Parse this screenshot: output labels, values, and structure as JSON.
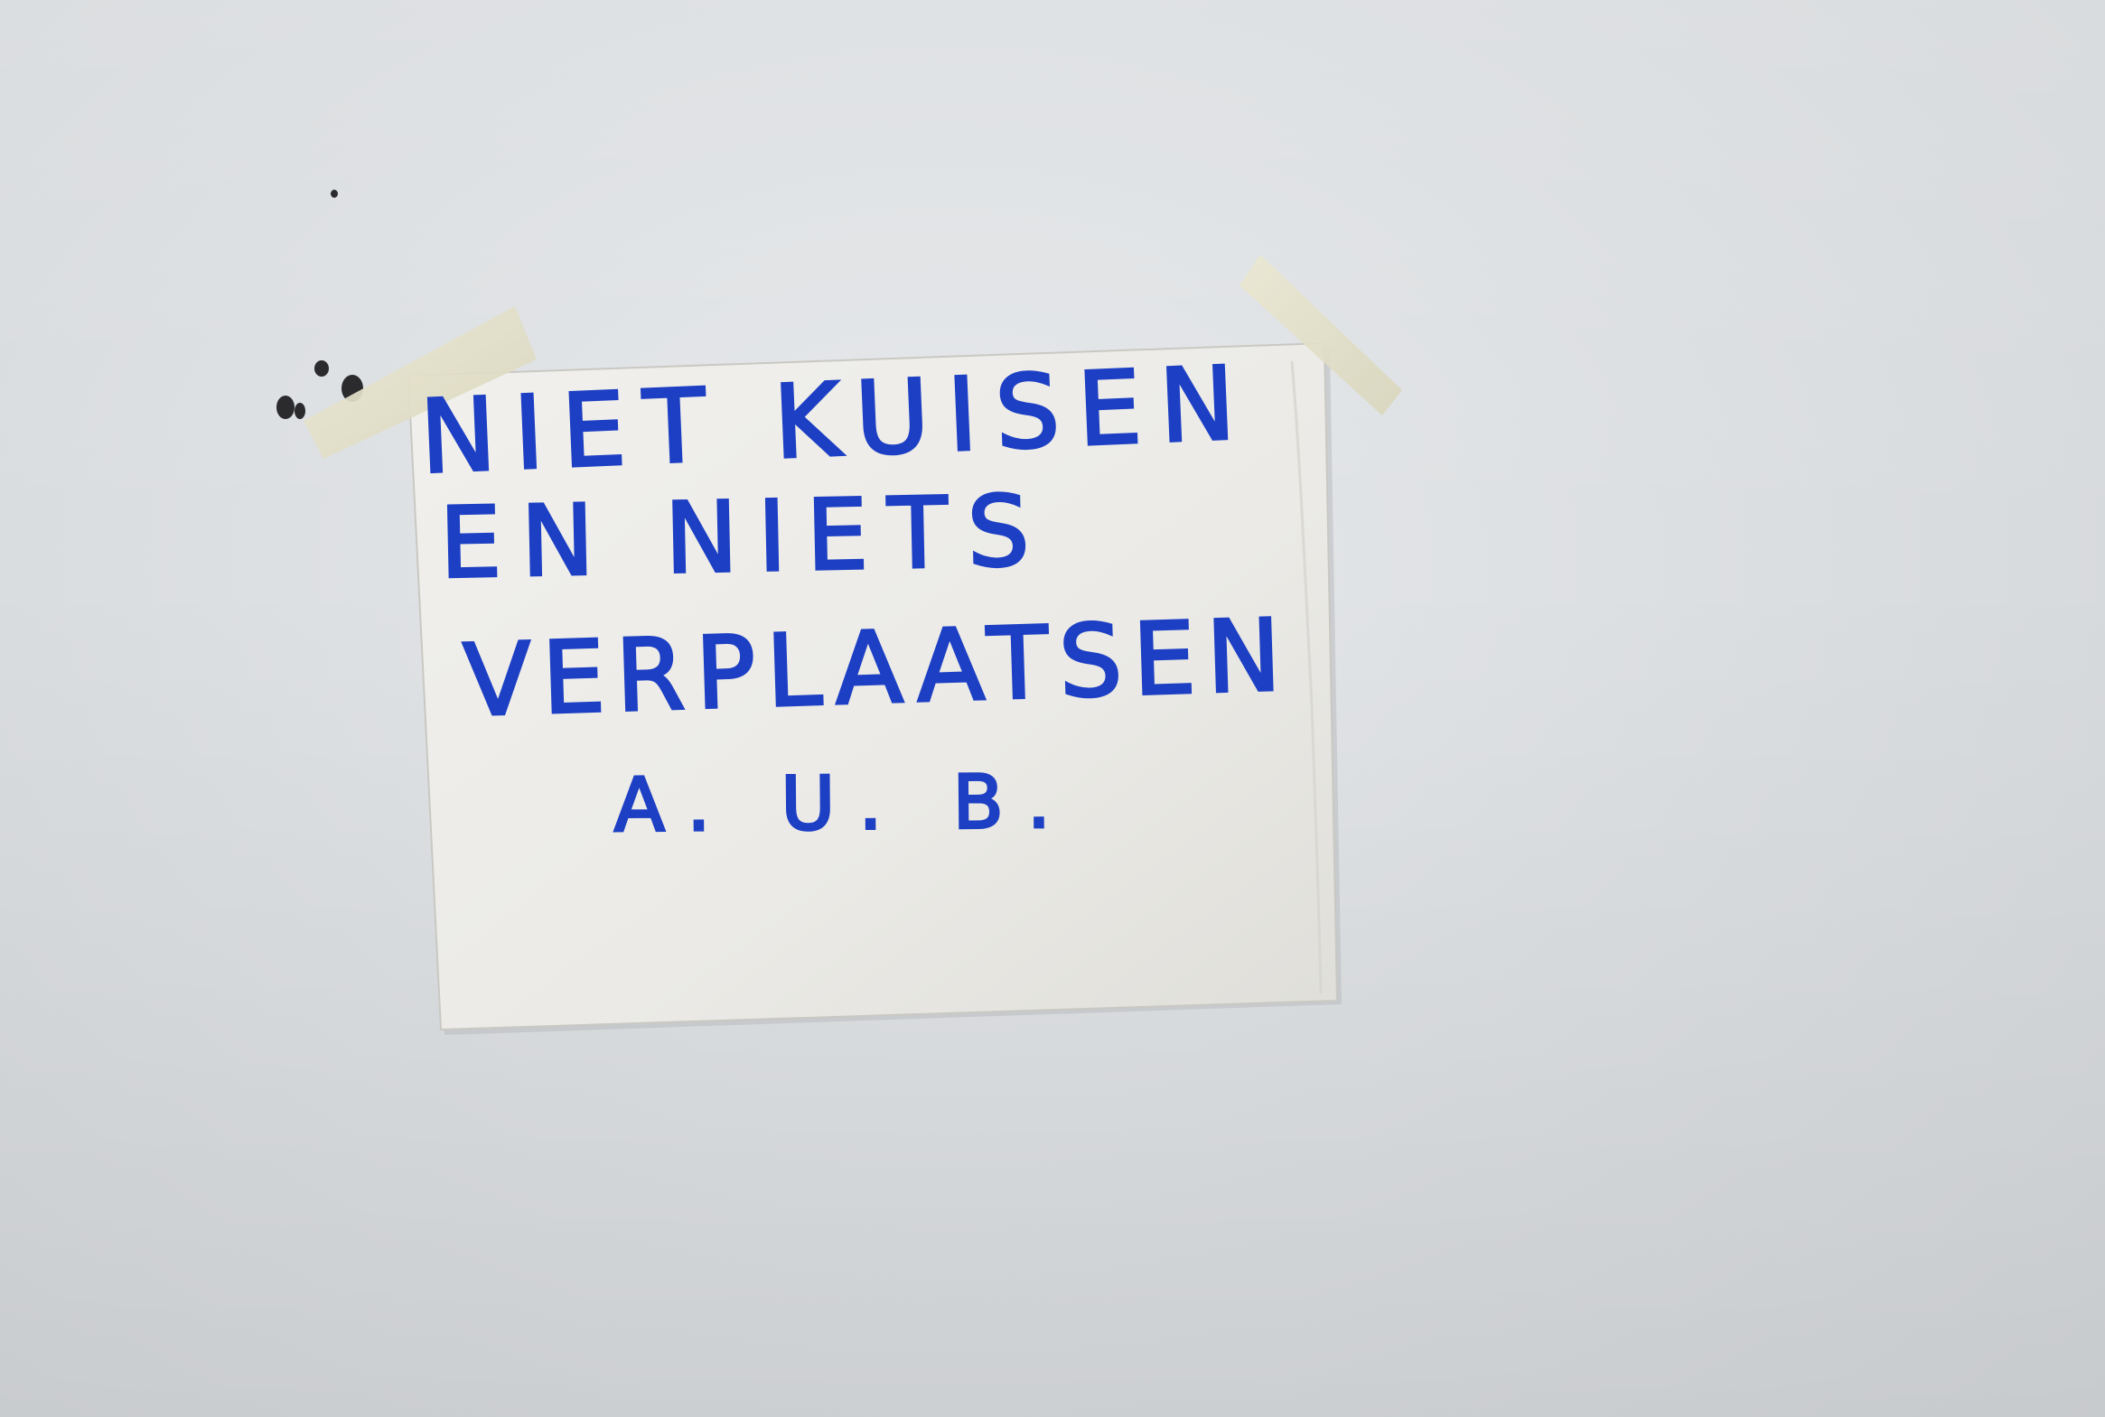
{
  "photo": {
    "wall_color": "#dcdfe2",
    "paper_color": "#ececea",
    "tape_color": "#e6e3cc",
    "ink_color": "#1d3fc4"
  },
  "sign": {
    "line1": "NIET KUISEN",
    "line2": "EN NIETS",
    "line3": "VERPLAATSEN",
    "line4": "A. U. B."
  }
}
